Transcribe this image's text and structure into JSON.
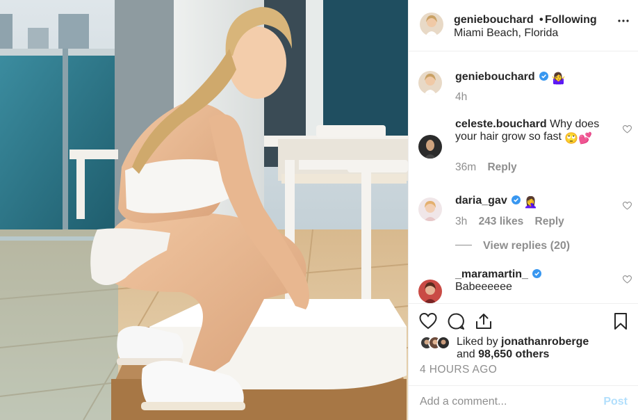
{
  "header": {
    "username": "geniebouchard",
    "separator": "•",
    "follow_status": "Following",
    "location": "Miami Beach, Florida",
    "more_icon": "more-options-icon"
  },
  "caption": {
    "username": "geniebouchard",
    "emoji": "🤷‍♀️",
    "age": "4h",
    "verified": true
  },
  "comments": [
    {
      "username": "celeste.bouchard",
      "text": "Why does your hair grow so fast",
      "emoji": "🙄💕",
      "age": "36m",
      "reply": "Reply"
    },
    {
      "username": "daria_gav",
      "verified": true,
      "emoji": "🤦‍♀️",
      "age": "3h",
      "likes": "243 likes",
      "reply": "Reply",
      "view_replies": "View replies (20)"
    },
    {
      "username": "_maramartin_",
      "verified": true,
      "text": "Babeeeeee"
    }
  ],
  "actions": {
    "icons": [
      "heart-icon",
      "comment-icon",
      "share-icon",
      "bookmark-icon"
    ],
    "liked_by_prefix": "Liked by",
    "liked_by_user": "jonathanroberge",
    "liked_by_conj": "and",
    "liked_by_others": "98,650 others",
    "timestamp": "4 HOURS AGO"
  },
  "add_comment": {
    "placeholder": "Add a comment...",
    "post_label": "Post"
  },
  "colors": {
    "text": "#262626",
    "muted": "#8e8e8e",
    "verified": "#3897f0",
    "post_disabled": "#b2dffc",
    "border": "#efefef"
  }
}
